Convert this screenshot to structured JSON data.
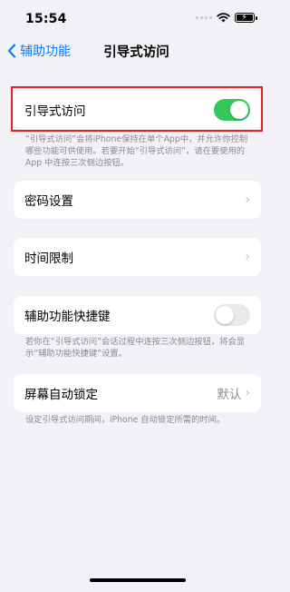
{
  "status_bar": {
    "time": "15:54"
  },
  "nav": {
    "back_label": "辅助功能",
    "title": "引导式访问"
  },
  "guided_access": {
    "label": "引导式访问",
    "enabled": true,
    "footnote": "“引导式访问”会将iPhone保持在单个App中，并允许你控制哪些功能可供使用。若要开始“引导式访问”，请在要使用的 App 中连按三次侧边按钮。"
  },
  "passcode": {
    "label": "密码设置"
  },
  "time_limits": {
    "label": "时间限制"
  },
  "accessibility_shortcut": {
    "label": "辅助功能快捷键",
    "enabled": false,
    "footnote": "若你在“引导式访问”会话过程中连按三次侧边按钮，将会显示“辅助功能快捷键”设置。"
  },
  "auto_lock": {
    "label": "屏幕自动锁定",
    "value": "默认",
    "footnote": "设定引导式访问期间，iPhone 自动锁定所需的时间。"
  },
  "colors": {
    "accent": "#0a7cff",
    "toggle_on": "#34c759",
    "highlight": "#e02424"
  },
  "icons": {
    "back": "chevron-left-icon",
    "wifi": "wifi-icon",
    "battery": "battery-charging-icon",
    "signal": "signal-icon"
  }
}
